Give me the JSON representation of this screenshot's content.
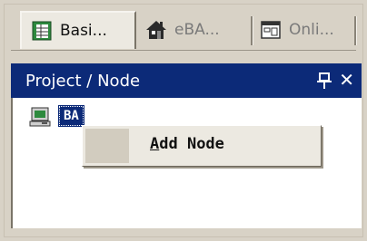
{
  "tabs": [
    {
      "label": "Basi...",
      "icon": "table-icon",
      "active": true
    },
    {
      "label": "eBA...",
      "icon": "home-icon",
      "active": false
    },
    {
      "label": "Onli...",
      "icon": "window-icon",
      "active": false
    }
  ],
  "panel": {
    "title": "Project / Node",
    "pin_icon": "pin-icon",
    "close_label": "✕"
  },
  "tree": {
    "node_label": "BA",
    "node_icon": "computer-icon"
  },
  "context_menu": {
    "items": [
      {
        "mnemonic": "A",
        "rest": "dd Node"
      }
    ]
  },
  "colors": {
    "title_bar": "#0c2a78",
    "selection": "#0c2a78",
    "window_bg": "#d8d2c6"
  }
}
